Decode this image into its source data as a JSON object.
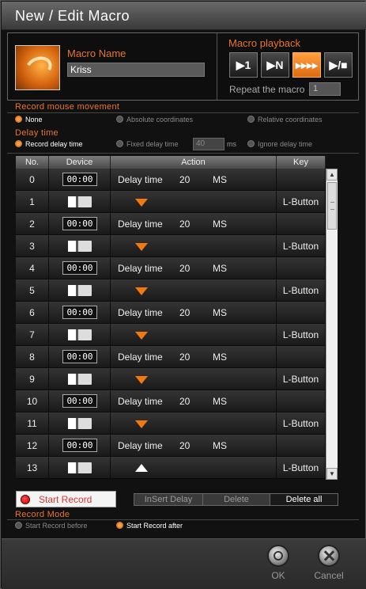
{
  "title": "New / Edit Macro",
  "macro_name": {
    "label": "Macro Name",
    "value": "Kriss"
  },
  "playback": {
    "label": "Macro playback",
    "buttons": [
      "▶1",
      "▶N",
      "▸▸▸▸",
      "▶/■"
    ],
    "active_index": 2,
    "repeat_label": "Repeat the macro",
    "repeat_value": "1"
  },
  "mouse_movement": {
    "label": "Record mouse movement",
    "options": [
      "None",
      "Absolute coordinates",
      "Relative coordinates"
    ],
    "selected": "None"
  },
  "delay_time": {
    "label": "Delay time",
    "options": [
      "Record delay time",
      "Fixed delay time",
      "Ignore delay time"
    ],
    "selected": "Record delay time",
    "fixed_value": "40",
    "fixed_unit": "ms"
  },
  "table": {
    "headers": [
      "No.",
      "Device",
      "Action",
      "Key"
    ],
    "rows": [
      {
        "no": "0",
        "device": "clock",
        "action": "delay",
        "delay_label": "Delay time",
        "value": "20",
        "unit": "MS",
        "key": ""
      },
      {
        "no": "1",
        "device": "mouse",
        "action": "down",
        "key": "L-Button"
      },
      {
        "no": "2",
        "device": "clock",
        "action": "delay",
        "delay_label": "Delay time",
        "value": "20",
        "unit": "MS",
        "key": ""
      },
      {
        "no": "3",
        "device": "mouse",
        "action": "down",
        "key": "L-Button"
      },
      {
        "no": "4",
        "device": "clock",
        "action": "delay",
        "delay_label": "Delay time",
        "value": "20",
        "unit": "MS",
        "key": ""
      },
      {
        "no": "5",
        "device": "mouse",
        "action": "down",
        "key": "L-Button"
      },
      {
        "no": "6",
        "device": "clock",
        "action": "delay",
        "delay_label": "Delay time",
        "value": "20",
        "unit": "MS",
        "key": ""
      },
      {
        "no": "7",
        "device": "mouse",
        "action": "down",
        "key": "L-Button"
      },
      {
        "no": "8",
        "device": "clock",
        "action": "delay",
        "delay_label": "Delay time",
        "value": "20",
        "unit": "MS",
        "key": ""
      },
      {
        "no": "9",
        "device": "mouse",
        "action": "down",
        "key": "L-Button"
      },
      {
        "no": "10",
        "device": "clock",
        "action": "delay",
        "delay_label": "Delay time",
        "value": "20",
        "unit": "MS",
        "key": ""
      },
      {
        "no": "11",
        "device": "mouse",
        "action": "down",
        "key": "L-Button"
      },
      {
        "no": "12",
        "device": "clock",
        "action": "delay",
        "delay_label": "Delay time",
        "value": "20",
        "unit": "MS",
        "key": ""
      },
      {
        "no": "13",
        "device": "mouse",
        "action": "up",
        "key": "L-Button"
      }
    ],
    "clock_text": "00:00"
  },
  "record": {
    "button_label": "Start Record",
    "tools": [
      "InSert Delay",
      "Delete",
      "Delete all"
    ],
    "active_tool": "Delete all"
  },
  "record_mode": {
    "label": "Record Mode",
    "options": [
      "Start Record before",
      "Start Record after"
    ],
    "selected": "Start Record after"
  },
  "footer": {
    "ok_label": "OK",
    "cancel_label": "Cancel"
  },
  "colors": {
    "accent": "#e8752a",
    "arrow": "#f07a10"
  }
}
